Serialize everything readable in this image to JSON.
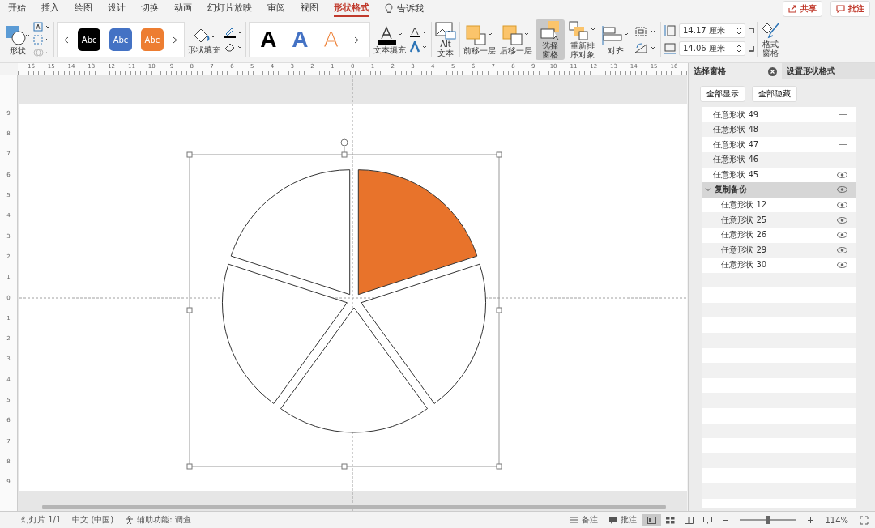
{
  "tabs": [
    {
      "label": "开始",
      "selected": false
    },
    {
      "label": "插入",
      "selected": false
    },
    {
      "label": "绘图",
      "selected": false
    },
    {
      "label": "设计",
      "selected": false
    },
    {
      "label": "切换",
      "selected": false
    },
    {
      "label": "动画",
      "selected": false
    },
    {
      "label": "幻灯片放映",
      "selected": false
    },
    {
      "label": "审阅",
      "selected": false
    },
    {
      "label": "视图",
      "selected": false
    },
    {
      "label": "形状格式",
      "selected": true
    }
  ],
  "tell_me": "告诉我",
  "share_button": "共享",
  "comments_button": "批注",
  "ribbon": {
    "shape_label": "形状",
    "style_gallery": [
      {
        "text": "Abc",
        "color": "#000000"
      },
      {
        "text": "Abc",
        "color": "#4472c4"
      },
      {
        "text": "Abc",
        "color": "#ed7d31"
      }
    ],
    "shape_fill": "形状填充",
    "wordart_gallery": [
      {
        "text": "A",
        "kind": "solid",
        "color": "#000000"
      },
      {
        "text": "A",
        "kind": "solid",
        "color": "#4472c4"
      },
      {
        "text": "A",
        "kind": "outline",
        "color": "#ed7d31"
      }
    ],
    "text_fill": "文本填充",
    "alt_text": [
      "Alt",
      "文本"
    ],
    "arrange": [
      {
        "kind": "forward",
        "lines": [
          "前移一层"
        ],
        "selected": false
      },
      {
        "kind": "backward",
        "lines": [
          "后移一层"
        ],
        "selected": false
      },
      {
        "kind": "pane",
        "lines": [
          "选择",
          "窗格"
        ],
        "selected": true
      },
      {
        "kind": "reorder",
        "lines": [
          "重新排",
          "序对象"
        ],
        "selected": false
      },
      {
        "kind": "align",
        "lines": [
          "对齐"
        ],
        "selected": false
      }
    ],
    "height": "14.17 厘米",
    "width": "14.06 厘米",
    "format_pane": [
      "格式",
      "窗格"
    ]
  },
  "ruler": {
    "horizontal": [
      "16",
      "15",
      "14",
      "13",
      "12",
      "11",
      "10",
      "9",
      "8",
      "7",
      "6",
      "5",
      "4",
      "3",
      "2",
      "1",
      "0",
      "1",
      "2",
      "3",
      "4",
      "5",
      "6",
      "7",
      "8",
      "9",
      "10",
      "11",
      "12",
      "13",
      "14",
      "15",
      "16"
    ],
    "vertical": [
      "9",
      "8",
      "7",
      "6",
      "5",
      "4",
      "3",
      "2",
      "1",
      "0",
      "1",
      "2",
      "3",
      "4",
      "5",
      "6",
      "7",
      "8",
      "9"
    ]
  },
  "slide": {
    "segments": [
      {
        "filled": true
      },
      {
        "filled": false
      },
      {
        "filled": false
      },
      {
        "filled": false
      },
      {
        "filled": false
      }
    ]
  },
  "selection_pane": {
    "tabs": [
      {
        "label": "选择窗格",
        "selected": true
      },
      {
        "label": "设置形状格式",
        "selected": false
      }
    ],
    "buttons": [
      "全部显示",
      "全部隐藏"
    ],
    "items": [
      {
        "name": "任意形状 49",
        "visible": false,
        "selected": false
      },
      {
        "name": "任意形状 48",
        "visible": false,
        "selected": false
      },
      {
        "name": "任意形状 47",
        "visible": false,
        "selected": false
      },
      {
        "name": "任意形状 46",
        "visible": false,
        "selected": false
      },
      {
        "name": "任意形状 45",
        "visible": true,
        "selected": false
      },
      {
        "name": "复制备份",
        "visible": true,
        "selected": true,
        "expanded": true,
        "children": [
          {
            "name": "任意形状 12",
            "visible": true,
            "selected": false
          },
          {
            "name": "任意形状 25",
            "visible": true,
            "selected": false
          },
          {
            "name": "任意形状 26",
            "visible": true,
            "selected": false
          },
          {
            "name": "任意形状 29",
            "visible": true,
            "selected": false
          },
          {
            "name": "任意形状 30",
            "visible": true,
            "selected": false
          }
        ]
      }
    ]
  },
  "status_bar": {
    "slide": "幻灯片 1/1",
    "language": "中文 (中国)",
    "accessibility": "辅助功能: 调查",
    "notes": "备注",
    "comments": "批注",
    "views": [
      {
        "selected": true
      },
      {
        "selected": false
      },
      {
        "selected": false
      },
      {
        "selected": false
      }
    ],
    "level": 0.5,
    "zoom": "114%"
  }
}
